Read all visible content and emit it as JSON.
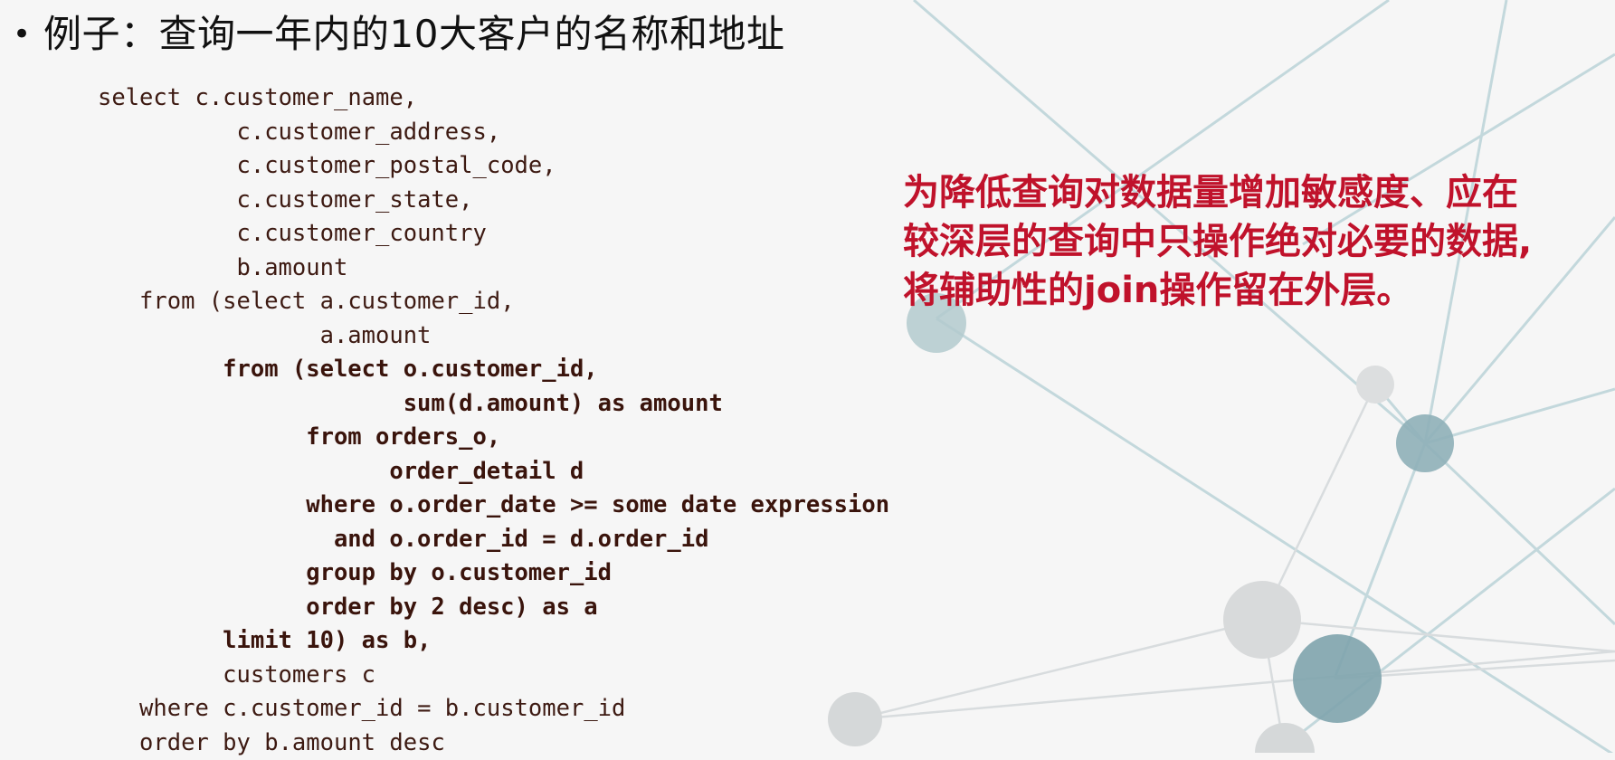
{
  "slide": {
    "bullet": "•",
    "title": "例子：查询一年内的10大客户的名称和地址",
    "code_lines": [
      {
        "text": "select c.customer_name,",
        "indent": 0,
        "bold": false
      },
      {
        "text": "c.customer_address,",
        "indent": 10,
        "bold": false
      },
      {
        "text": "c.customer_postal_code,",
        "indent": 10,
        "bold": false
      },
      {
        "text": "c.customer_state,",
        "indent": 10,
        "bold": false
      },
      {
        "text": "c.customer_country",
        "indent": 10,
        "bold": false
      },
      {
        "text": "b.amount",
        "indent": 10,
        "bold": false
      },
      {
        "text": "from (select a.customer_id,",
        "indent": 3,
        "bold": false
      },
      {
        "text": "a.amount",
        "indent": 16,
        "bold": false
      },
      {
        "text": "from (select o.customer_id,",
        "indent": 9,
        "bold": true
      },
      {
        "text": "sum(d.amount) as amount",
        "indent": 22,
        "bold": true
      },
      {
        "text": "from orders_o,",
        "indent": 15,
        "bold": true
      },
      {
        "text": "order_detail d",
        "indent": 21,
        "bold": true
      },
      {
        "text": "where o.order_date >= some date expression",
        "indent": 15,
        "bold": true
      },
      {
        "text": "and o.order_id = d.order_id",
        "indent": 17,
        "bold": true
      },
      {
        "text": "group by o.customer_id",
        "indent": 15,
        "bold": true
      },
      {
        "text": "order by 2 desc) as a",
        "indent": 15,
        "bold": true
      },
      {
        "text": "limit 10) as b,",
        "indent": 9,
        "bold": true
      },
      {
        "text": "customers c",
        "indent": 9,
        "bold": false
      },
      {
        "text": "where c.customer_id = b.customer_id",
        "indent": 3,
        "bold": false
      },
      {
        "text": "order by b.amount desc",
        "indent": 3,
        "bold": false
      }
    ],
    "note_lines": [
      "为降低查询对数据量增加敏感度、应在",
      "较深层的查询中只操作绝对必要的数据,",
      "将辅助性的join操作留在外层。"
    ],
    "colors": {
      "background": "#f6f6f6",
      "note_text": "#c0122b",
      "code_text": "#3d1a12",
      "network_line": "#bcd3d8",
      "node_teal": "#8fb0b8",
      "node_gray": "#d5d8d9"
    }
  }
}
